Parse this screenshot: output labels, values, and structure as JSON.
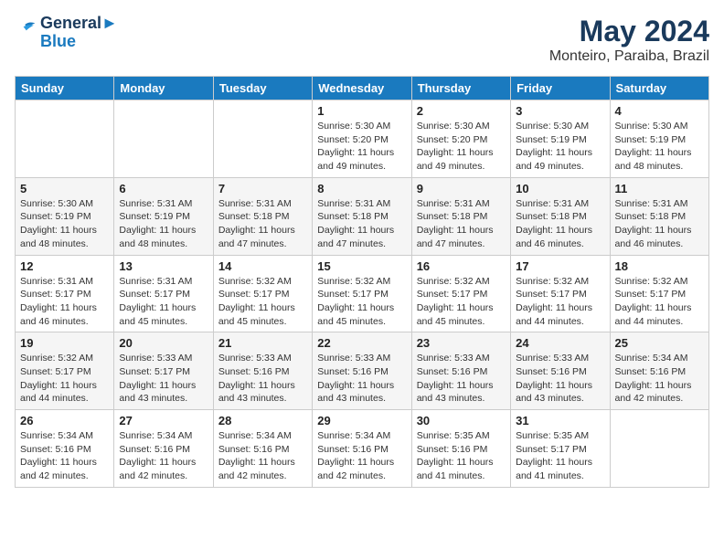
{
  "header": {
    "logo_line1": "General",
    "logo_line2": "Blue",
    "month": "May 2024",
    "location": "Monteiro, Paraiba, Brazil"
  },
  "days_of_week": [
    "Sunday",
    "Monday",
    "Tuesday",
    "Wednesday",
    "Thursday",
    "Friday",
    "Saturday"
  ],
  "weeks": [
    [
      null,
      null,
      null,
      {
        "day": "1",
        "sunrise": "5:30 AM",
        "sunset": "5:20 PM",
        "daylight": "11 hours and 49 minutes."
      },
      {
        "day": "2",
        "sunrise": "5:30 AM",
        "sunset": "5:20 PM",
        "daylight": "11 hours and 49 minutes."
      },
      {
        "day": "3",
        "sunrise": "5:30 AM",
        "sunset": "5:19 PM",
        "daylight": "11 hours and 49 minutes."
      },
      {
        "day": "4",
        "sunrise": "5:30 AM",
        "sunset": "5:19 PM",
        "daylight": "11 hours and 48 minutes."
      }
    ],
    [
      {
        "day": "5",
        "sunrise": "5:30 AM",
        "sunset": "5:19 PM",
        "daylight": "11 hours and 48 minutes."
      },
      {
        "day": "6",
        "sunrise": "5:31 AM",
        "sunset": "5:19 PM",
        "daylight": "11 hours and 48 minutes."
      },
      {
        "day": "7",
        "sunrise": "5:31 AM",
        "sunset": "5:18 PM",
        "daylight": "11 hours and 47 minutes."
      },
      {
        "day": "8",
        "sunrise": "5:31 AM",
        "sunset": "5:18 PM",
        "daylight": "11 hours and 47 minutes."
      },
      {
        "day": "9",
        "sunrise": "5:31 AM",
        "sunset": "5:18 PM",
        "daylight": "11 hours and 47 minutes."
      },
      {
        "day": "10",
        "sunrise": "5:31 AM",
        "sunset": "5:18 PM",
        "daylight": "11 hours and 46 minutes."
      },
      {
        "day": "11",
        "sunrise": "5:31 AM",
        "sunset": "5:18 PM",
        "daylight": "11 hours and 46 minutes."
      }
    ],
    [
      {
        "day": "12",
        "sunrise": "5:31 AM",
        "sunset": "5:17 PM",
        "daylight": "11 hours and 46 minutes."
      },
      {
        "day": "13",
        "sunrise": "5:31 AM",
        "sunset": "5:17 PM",
        "daylight": "11 hours and 45 minutes."
      },
      {
        "day": "14",
        "sunrise": "5:32 AM",
        "sunset": "5:17 PM",
        "daylight": "11 hours and 45 minutes."
      },
      {
        "day": "15",
        "sunrise": "5:32 AM",
        "sunset": "5:17 PM",
        "daylight": "11 hours and 45 minutes."
      },
      {
        "day": "16",
        "sunrise": "5:32 AM",
        "sunset": "5:17 PM",
        "daylight": "11 hours and 45 minutes."
      },
      {
        "day": "17",
        "sunrise": "5:32 AM",
        "sunset": "5:17 PM",
        "daylight": "11 hours and 44 minutes."
      },
      {
        "day": "18",
        "sunrise": "5:32 AM",
        "sunset": "5:17 PM",
        "daylight": "11 hours and 44 minutes."
      }
    ],
    [
      {
        "day": "19",
        "sunrise": "5:32 AM",
        "sunset": "5:17 PM",
        "daylight": "11 hours and 44 minutes."
      },
      {
        "day": "20",
        "sunrise": "5:33 AM",
        "sunset": "5:17 PM",
        "daylight": "11 hours and 43 minutes."
      },
      {
        "day": "21",
        "sunrise": "5:33 AM",
        "sunset": "5:16 PM",
        "daylight": "11 hours and 43 minutes."
      },
      {
        "day": "22",
        "sunrise": "5:33 AM",
        "sunset": "5:16 PM",
        "daylight": "11 hours and 43 minutes."
      },
      {
        "day": "23",
        "sunrise": "5:33 AM",
        "sunset": "5:16 PM",
        "daylight": "11 hours and 43 minutes."
      },
      {
        "day": "24",
        "sunrise": "5:33 AM",
        "sunset": "5:16 PM",
        "daylight": "11 hours and 43 minutes."
      },
      {
        "day": "25",
        "sunrise": "5:34 AM",
        "sunset": "5:16 PM",
        "daylight": "11 hours and 42 minutes."
      }
    ],
    [
      {
        "day": "26",
        "sunrise": "5:34 AM",
        "sunset": "5:16 PM",
        "daylight": "11 hours and 42 minutes."
      },
      {
        "day": "27",
        "sunrise": "5:34 AM",
        "sunset": "5:16 PM",
        "daylight": "11 hours and 42 minutes."
      },
      {
        "day": "28",
        "sunrise": "5:34 AM",
        "sunset": "5:16 PM",
        "daylight": "11 hours and 42 minutes."
      },
      {
        "day": "29",
        "sunrise": "5:34 AM",
        "sunset": "5:16 PM",
        "daylight": "11 hours and 42 minutes."
      },
      {
        "day": "30",
        "sunrise": "5:35 AM",
        "sunset": "5:16 PM",
        "daylight": "11 hours and 41 minutes."
      },
      {
        "day": "31",
        "sunrise": "5:35 AM",
        "sunset": "5:17 PM",
        "daylight": "11 hours and 41 minutes."
      },
      null
    ]
  ],
  "labels": {
    "sunrise_prefix": "Sunrise: ",
    "sunset_prefix": "Sunset: ",
    "daylight_prefix": "Daylight: "
  }
}
